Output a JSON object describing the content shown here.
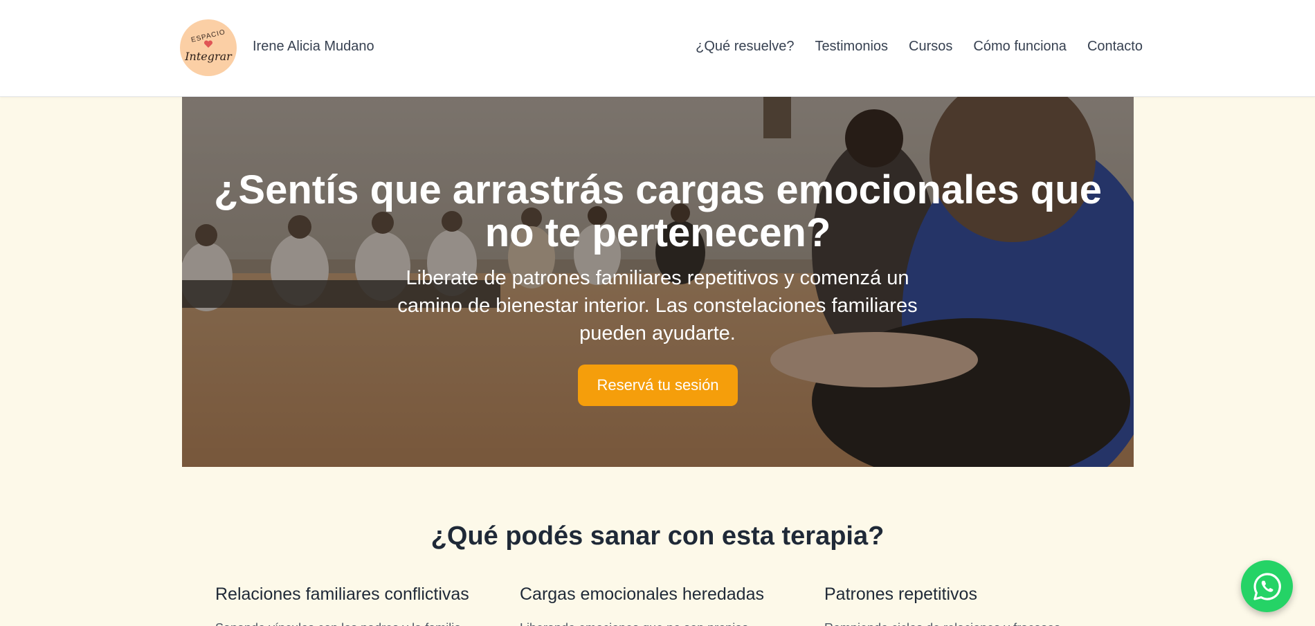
{
  "header": {
    "logo": {
      "top_text": "ESPACIO",
      "main_text": "Integrar",
      "bg_color": "#fbcfa5",
      "heart_color": "#e05656"
    },
    "brand_name": "Irene Alicia Mudano",
    "nav": [
      {
        "label": "¿Qué resuelve?"
      },
      {
        "label": "Testimonios"
      },
      {
        "label": "Cursos"
      },
      {
        "label": "Cómo funciona"
      },
      {
        "label": "Contacto"
      }
    ]
  },
  "hero": {
    "title": "¿Sentís que arrastrás cargas emocionales que no te pertenecen?",
    "subtitle": "Liberate de patrones familiares repetitivos y comenzá un camino de bienestar interior. Las constelaciones familiares pueden ayudarte.",
    "cta_label": "Reservá tu sesión",
    "cta_color": "#f59e0b"
  },
  "section": {
    "title": "¿Qué podés sanar con esta terapia?",
    "features": [
      {
        "title": "Relaciones familiares conflictivas",
        "desc": "Sanando vínculos con los padres y la familia"
      },
      {
        "title": "Cargas emocionales heredadas",
        "desc": "Liberando emociones que no son propias"
      },
      {
        "title": "Patrones repetitivos",
        "desc": "Rompiendo ciclos de relaciones y fracasos"
      }
    ]
  },
  "whatsapp": {
    "icon": "whatsapp-icon",
    "color": "#25d366"
  },
  "colors": {
    "page_bg": "#fdf9e9",
    "header_bg": "#ffffff",
    "text": "#1f2937"
  }
}
